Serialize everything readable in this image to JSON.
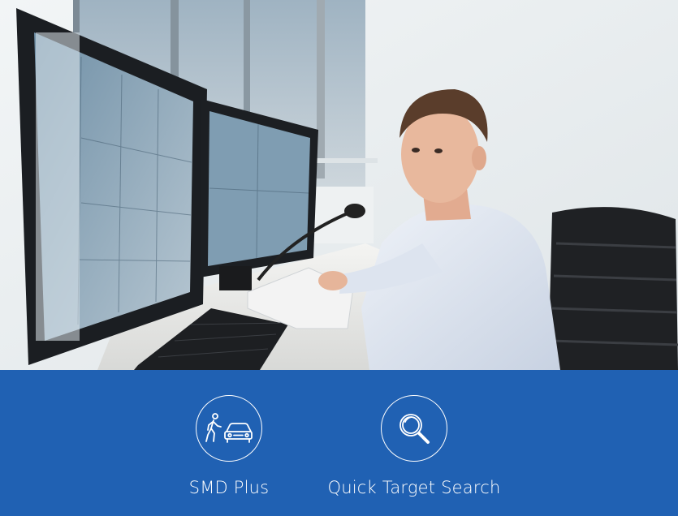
{
  "photo": {
    "subject": "security-operator-at-monitors"
  },
  "features": [
    {
      "label": "SMD Plus",
      "icon": "person-and-car-icon"
    },
    {
      "label": "Quick Target Search",
      "icon": "magnifier-icon"
    }
  ],
  "colors": {
    "banner": "#2061b3",
    "icon_stroke": "#ffffff",
    "text": "#ffffff"
  }
}
